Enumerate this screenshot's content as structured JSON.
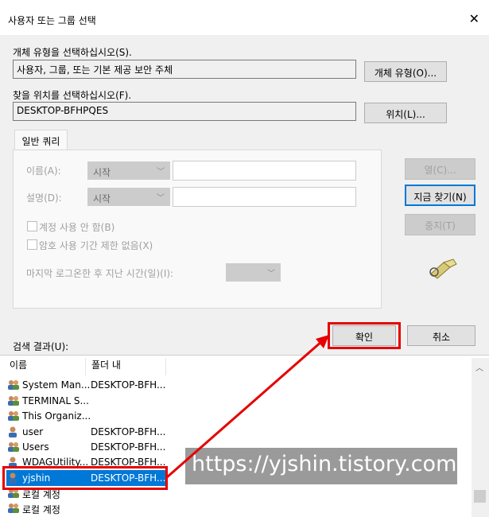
{
  "dialog": {
    "title": "사용자 또는 그룹 선택",
    "close_symbol": "✕"
  },
  "object_type": {
    "label": "개체 유형을 선택하십시오(S).",
    "value": "사용자, 그룹, 또는 기본 제공 보안 주체",
    "button": "개체 유형(O)..."
  },
  "location": {
    "label": "찾을 위치를 선택하십시오(F).",
    "value": "DESKTOP-BFHPQES",
    "button": "위치(L)..."
  },
  "query": {
    "tab": "일반 쿼리",
    "name_label": "이름(A):",
    "name_combo": "시작",
    "desc_label": "설명(D):",
    "desc_combo": "시작",
    "disabled_accounts": "계정 사용 안 함(B)",
    "non_expiring": "암호 사용 기간 제한 없음(X)",
    "last_logon_label": "마지막 로그온한 후 지난 시간(일)(I):"
  },
  "side_buttons": {
    "columns": "열(C)...",
    "find_now": "지금 찾기(N)",
    "stop": "중지(T)"
  },
  "actions": {
    "ok": "확인",
    "cancel": "취소"
  },
  "results": {
    "label": "검색 결과(U):",
    "col_name": "이름",
    "col_folder": "폴더 내",
    "rows": [
      {
        "name": "System Man...",
        "folder": "DESKTOP-BFH...",
        "icon": "group-icon"
      },
      {
        "name": "TERMINAL S...",
        "folder": "",
        "icon": "group-icon"
      },
      {
        "name": "This Organiz...",
        "folder": "",
        "icon": "group-icon"
      },
      {
        "name": "user",
        "folder": "DESKTOP-BFH...",
        "icon": "user-icon"
      },
      {
        "name": "Users",
        "folder": "DESKTOP-BFH...",
        "icon": "group-icon"
      },
      {
        "name": "WDAGUtility...",
        "folder": "DESKTOP-BFH...",
        "icon": "user-icon"
      },
      {
        "name": "yjshin",
        "folder": "DESKTOP-BFH...",
        "icon": "user-icon"
      },
      {
        "name": "로컬 계정",
        "folder": "",
        "icon": "group-icon"
      },
      {
        "name": "로컬 계정",
        "folder": "",
        "icon": "group-icon"
      }
    ]
  },
  "watermark": "https://yjshin.tistory.com",
  "colors": {
    "highlight": "#0078d7",
    "annotation_red": "#e60000"
  }
}
